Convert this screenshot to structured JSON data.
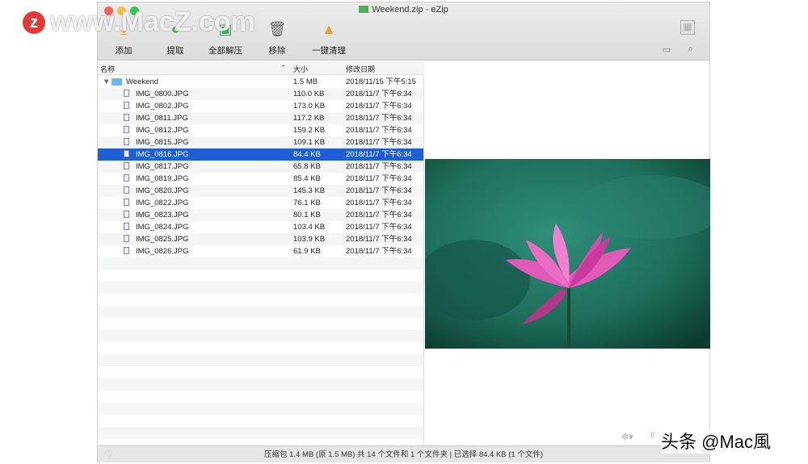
{
  "window": {
    "title": "Weekend.zip - eZip"
  },
  "toolbar": [
    {
      "label": "添加",
      "icon": "add-icon"
    },
    {
      "label": "提取",
      "icon": "extract-icon"
    },
    {
      "label": "全部解压",
      "icon": "extract-all-icon"
    },
    {
      "label": "移除",
      "icon": "trash-icon"
    },
    {
      "label": "一键清理",
      "icon": "broom-icon"
    }
  ],
  "columns": {
    "name": "名称",
    "size": "大小",
    "date": "修改日期"
  },
  "folder": {
    "name": "Weekend",
    "size": "1.5 MB",
    "date": "2018/11/15 下午5:15"
  },
  "files": [
    {
      "name": "IMG_0800.JPG",
      "size": "110.0 KB",
      "date": "2018/11/7 下午6:34"
    },
    {
      "name": "IMG_0802.JPG",
      "size": "173.0 KB",
      "date": "2018/11/7 下午6:34"
    },
    {
      "name": "IMG_0811.JPG",
      "size": "117.2 KB",
      "date": "2018/11/7 下午6:34"
    },
    {
      "name": "IMG_0812.JPG",
      "size": "159.2 KB",
      "date": "2018/11/7 下午6:34"
    },
    {
      "name": "IMG_0815.JPG",
      "size": "109.1 KB",
      "date": "2018/11/7 下午6:34"
    },
    {
      "name": "IMG_0816.JPG",
      "size": "84.4 KB",
      "date": "2018/11/7 下午6:34",
      "selected": true
    },
    {
      "name": "IMG_0817.JPG",
      "size": "65.8 KB",
      "date": "2018/11/7 下午6:34"
    },
    {
      "name": "IMG_0819.JPG",
      "size": "85.4 KB",
      "date": "2018/11/7 下午6:34"
    },
    {
      "name": "IMG_0820.JPG",
      "size": "145.3 KB",
      "date": "2018/11/7 下午6:34"
    },
    {
      "name": "IMG_0822.JPG",
      "size": "76.1 KB",
      "date": "2018/11/7 下午6:34"
    },
    {
      "name": "IMG_0823.JPG",
      "size": "80.1 KB",
      "date": "2018/11/7 下午6:34"
    },
    {
      "name": "IMG_0824.JPG",
      "size": "103.4 KB",
      "date": "2018/11/7 下午6:34"
    },
    {
      "name": "IMG_0825.JPG",
      "size": "103.9 KB",
      "date": "2018/11/7 下午6:34"
    },
    {
      "name": "IMG_0826.JPG",
      "size": "61.9 KB",
      "date": "2018/11/7 下午6:34"
    }
  ],
  "status": "压缩包 1.4 MB (原 1.5 MB) 共 14 个文件和 1 个文件夹  |  已选择 84.4 KB (1 个文件)",
  "watermarks": {
    "top": "www.MacZ.com",
    "bottom": "头条 @Mac風"
  },
  "colors": {
    "selection": "#1f5fd6"
  }
}
